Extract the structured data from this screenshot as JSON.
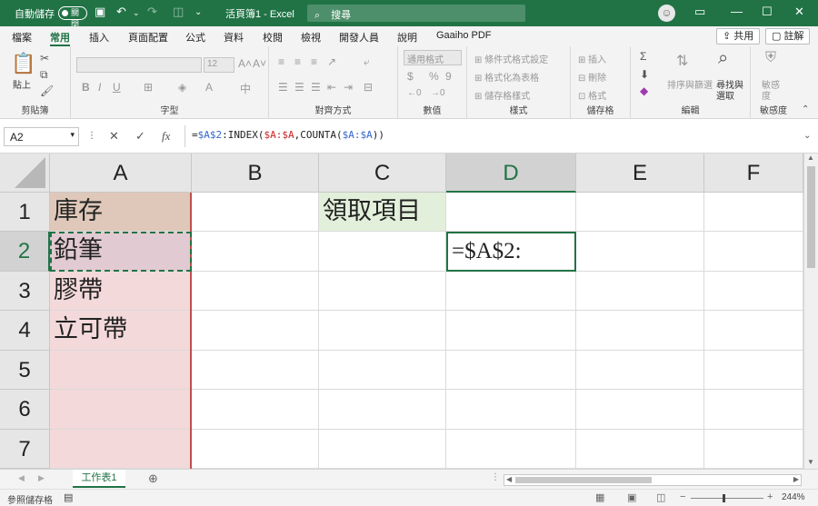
{
  "titlebar": {
    "autosave_label": "自動儲存",
    "autosave_state": "關閉",
    "doc_title": "活頁簿1  -  Excel",
    "search_placeholder": "搜尋",
    "accent_color": "#217346"
  },
  "tabs": [
    "檔案",
    "常用",
    "插入",
    "頁面配置",
    "公式",
    "資料",
    "校閱",
    "檢視",
    "開發人員",
    "說明",
    "Gaaiho PDF"
  ],
  "active_tab": "常用",
  "share_label": "共用",
  "comment_label": "註解",
  "ribbon": {
    "clipboard": {
      "label": "剪貼簿",
      "paste": "貼上"
    },
    "font": {
      "label": "字型",
      "size": "12",
      "bold": "B",
      "italic": "I",
      "underline": "U"
    },
    "alignment": {
      "label": "對齊方式"
    },
    "number": {
      "label": "數值",
      "format": "通用格式",
      "currency": "$",
      "percent": "%",
      "comma": "9"
    },
    "styles": {
      "label": "樣式",
      "cond": "條件式格式設定",
      "table": "格式化為表格",
      "cell": "儲存格樣式"
    },
    "cells": {
      "label": "儲存格",
      "insert": "插入",
      "delete": "刪除",
      "format": "格式"
    },
    "editing": {
      "label": "編輯",
      "sort": "排序與篩選",
      "find": "尋找與",
      "select": "選取"
    },
    "sensitivity": {
      "label": "敏感度",
      "btn": "敏感",
      "btn2": "度"
    }
  },
  "name_box": "A2",
  "formula": {
    "p1": "=",
    "p2": "$A$2",
    "p3": ":INDEX(",
    "p4": "$A:$A",
    "p5": ",COUNTA(",
    "p6": "$A:$A",
    "p7": "))"
  },
  "columns": [
    "A",
    "B",
    "C",
    "D",
    "E",
    "F"
  ],
  "rows": [
    "1",
    "2",
    "3",
    "4",
    "5",
    "6",
    "7"
  ],
  "cells": {
    "A1": "庫存",
    "A2": "鉛筆",
    "A3": "膠帶",
    "A4": "立可帶",
    "C1": "領取項目",
    "D2": "=$A$2:"
  },
  "sheet_tab": "工作表1",
  "status": {
    "mode": "參照儲存格",
    "zoom": "244%"
  }
}
